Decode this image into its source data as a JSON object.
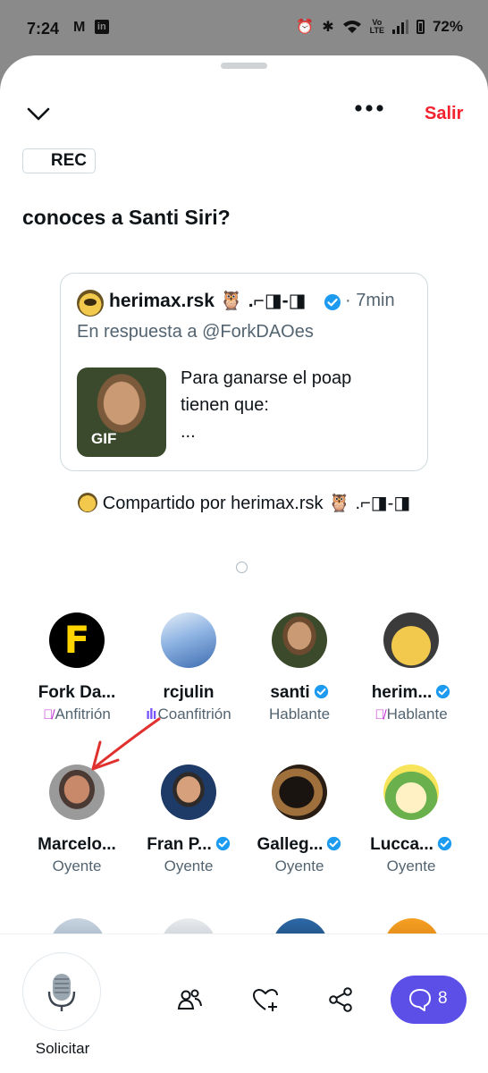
{
  "status_bar": {
    "time": "7:24",
    "app_icons": [
      "M",
      "in"
    ],
    "volte": "Vo\nLTE",
    "battery": "72%"
  },
  "header": {
    "salir_label": "Salir",
    "rec_label": "REC"
  },
  "space": {
    "title": "conoces a Santi Siri?"
  },
  "pinned_tweet": {
    "author": "herimax.rsk 🦉 .⌐◨-◨",
    "time": "· 7min",
    "reply_to": "En respuesta a @ForkDAOes",
    "media_label": "GIF",
    "text": "Para ganarse el poap\ntienen que:\n..."
  },
  "shared_by": "Compartido por herimax.rsk 🦉 .⌐◨-◨",
  "participants": [
    {
      "name": "Fork Da...",
      "role": "Anfitrión",
      "role_icon": "mic-muted-icon",
      "verified": false
    },
    {
      "name": "rcjulin",
      "role": "Coanfitrión",
      "role_icon": "speaking-bars-icon",
      "verified": false
    },
    {
      "name": "santi",
      "role": "Hablante",
      "role_icon": "",
      "verified": true
    },
    {
      "name": "herim...",
      "role": "Hablante",
      "role_icon": "mic-muted-icon",
      "verified": true
    },
    {
      "name": "Marcelo...",
      "role": "Oyente",
      "role_icon": "",
      "verified": false
    },
    {
      "name": "Fran P...",
      "role": "Oyente",
      "role_icon": "",
      "verified": true
    },
    {
      "name": "Galleg...",
      "role": "Oyente",
      "role_icon": "",
      "verified": true
    },
    {
      "name": "Lucca...",
      "role": "Oyente",
      "role_icon": "",
      "verified": true
    }
  ],
  "bottom_bar": {
    "request_label": "Solicitar",
    "chat_count": "8"
  },
  "colors": {
    "salir_red": "#f4212e",
    "verified_blue": "#1d9bf0",
    "chat_purple": "#5b4fe8",
    "annotation_red": "#e0312f"
  }
}
